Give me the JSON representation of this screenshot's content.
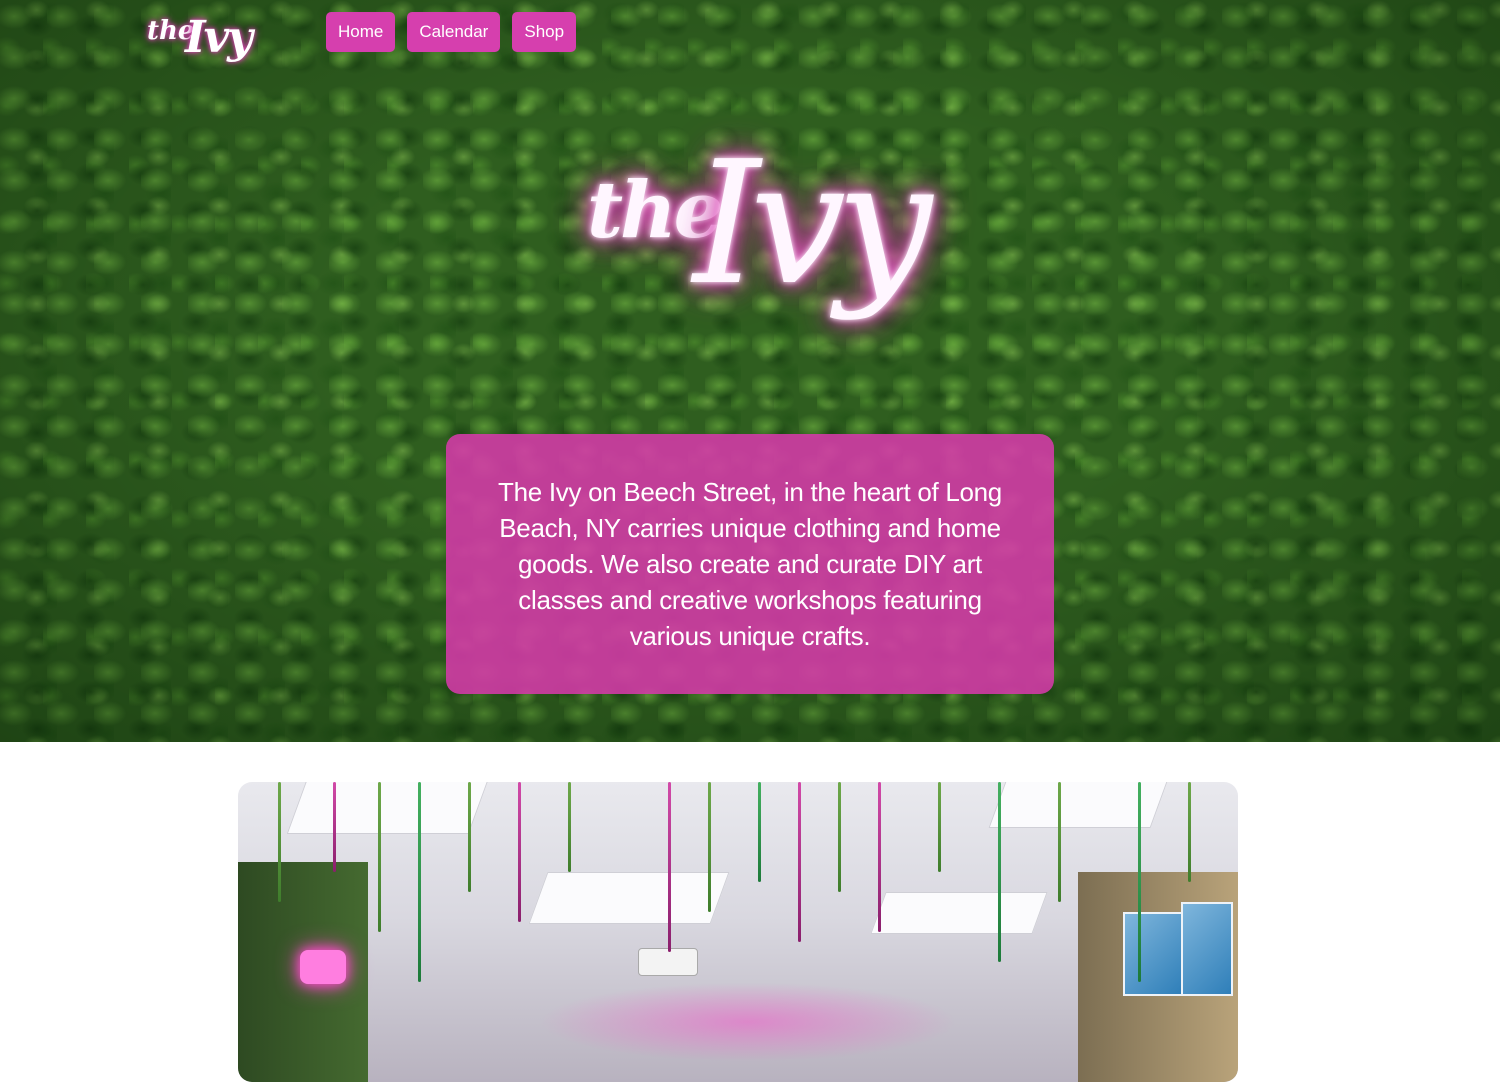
{
  "brand": {
    "logo_the": "the",
    "logo_ivy": "Ivy"
  },
  "nav": {
    "items": [
      {
        "label": "Home"
      },
      {
        "label": "Calendar"
      },
      {
        "label": "Shop"
      }
    ]
  },
  "hero": {
    "logo_the": "the",
    "logo_ivy": "Ivy",
    "intro": "The Ivy on Beech Street, in the heart of Long Beach, NY carries unique clothing and home goods. We also create and curate DIY art classes and creative workshops featuring various unique crafts."
  },
  "colors": {
    "accent": "#d63fae",
    "hero_background": "#2f5e1f",
    "intro_box": "#d63aaa",
    "nav_text": "#ffffff"
  },
  "icons": {
    "logo": "the-ivy-neon-script-logo"
  }
}
